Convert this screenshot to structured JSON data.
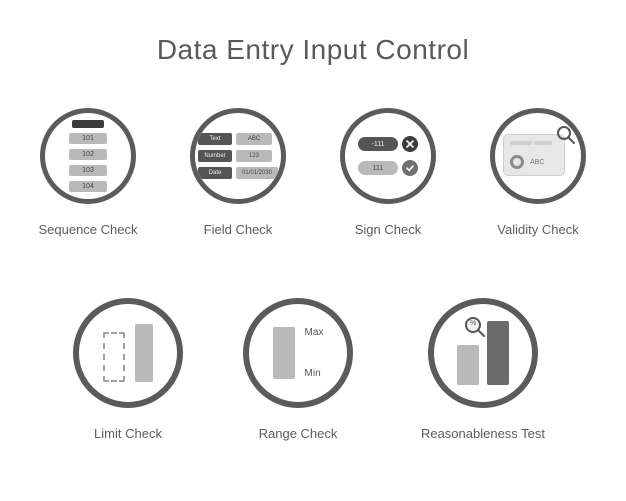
{
  "title": "Data Entry Input Control",
  "items": [
    {
      "label": "Sequence Check",
      "seq": [
        "101",
        "102",
        "103",
        "104"
      ]
    },
    {
      "label": "Field Check",
      "fields": [
        [
          "Text",
          "ABC"
        ],
        [
          "Number",
          "123"
        ],
        [
          "Date",
          "01/01/2030"
        ]
      ]
    },
    {
      "label": "Sign Check",
      "neg": "-111",
      "pos": "111"
    },
    {
      "label": "Validity Check",
      "abc": "ABC"
    },
    {
      "label": "Limit Check"
    },
    {
      "label": "Range Check",
      "max": "Max",
      "min": "Min"
    },
    {
      "label": "Reasonableness Test",
      "pct": "%"
    }
  ]
}
